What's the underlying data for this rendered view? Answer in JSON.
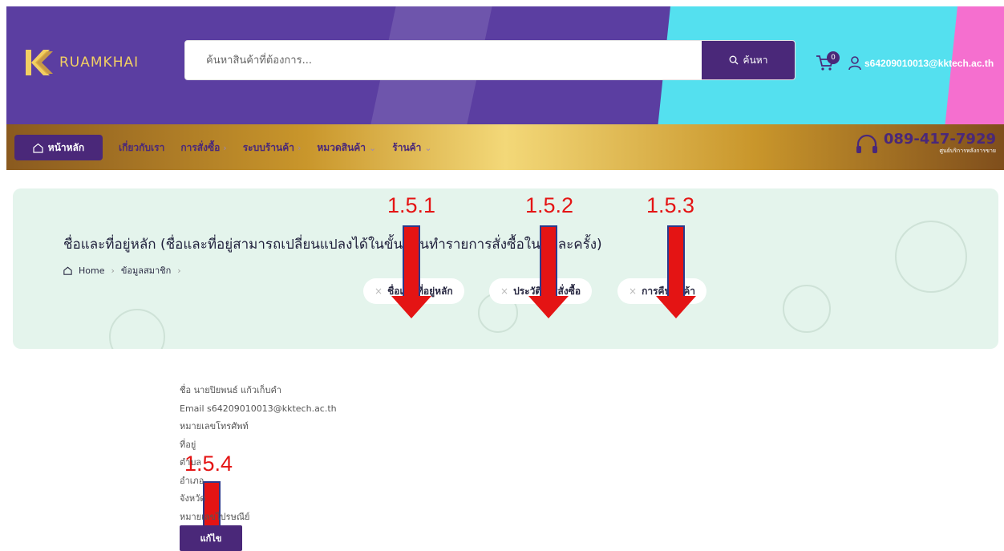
{
  "header": {
    "logo_text": "RUAMKHAI",
    "search": {
      "placeholder": "ค้นหาสินค้าที่ต้องการ...",
      "button_label": "ค้นหา"
    },
    "cart_count": "0",
    "user_email": "s64209010013@kktech.ac.th"
  },
  "nav": {
    "home_label": "หน้าหลัก",
    "items": [
      {
        "label": "เกี่ยวกับเรา",
        "chevron": ""
      },
      {
        "label": "การสั่งซื้อ",
        "chevron": "›"
      },
      {
        "label": "ระบบร้านค้า",
        "chevron": "›"
      },
      {
        "label": "หมวดสินค้า",
        "chevron": "⌄"
      },
      {
        "label": "ร้านค้า",
        "chevron": "⌄"
      }
    ],
    "hotline": {
      "number": "089-417-7929",
      "caption": "ศูนย์บริการหลังการขาย"
    }
  },
  "banner": {
    "title": "ชื่อและที่อยู่หลัก (ชื่อและที่อยู่สามารถเปลี่ยนแปลงได้ในขั้นตอนทำรายการสั่งซื้อในแต่ละครั้ง)",
    "breadcrumb": [
      "Home",
      "ข้อมูลสมาชิก"
    ],
    "tabs": [
      {
        "label": "ชื่อและที่อยู่หลัก"
      },
      {
        "label": "ประวัติการสั่งซื้อ"
      },
      {
        "label": "การคืนสินค้า"
      }
    ]
  },
  "annotations": [
    "1.5.1",
    "1.5.2",
    "1.5.3",
    "1.5.4"
  ],
  "profile": {
    "lines": [
      "ชื่อ นายปิยพนธ์ แก้วเก็บคำ",
      "Email s64209010013@kktech.ac.th",
      "หมายเลขโทรศัพท์",
      "ที่อยู่",
      "ตำบล",
      "อำเภอ",
      "จังหวัด",
      "หมายเลขไปรษณีย์"
    ],
    "edit_label": "แก้ไข"
  },
  "colors": {
    "primary": "#4a2879",
    "header_bg": "#5b3ea1",
    "accent_cyan": "#54e0ef",
    "accent_pink": "#f56fcf",
    "gold": "#f2cf63",
    "banner_bg": "#e4f4ec",
    "annotation_red": "#e41414"
  }
}
